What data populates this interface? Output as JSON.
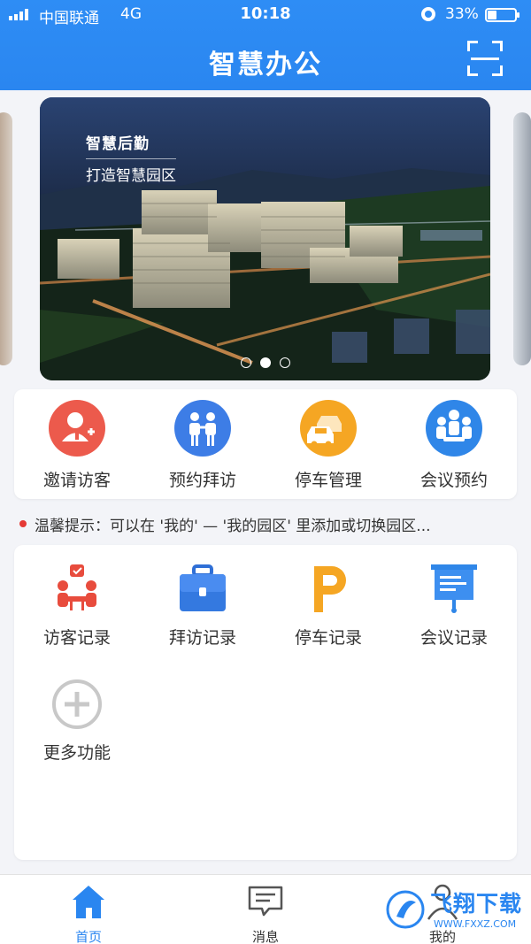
{
  "status_bar": {
    "carrier": "中国联通",
    "network": "4G",
    "time": "10:18",
    "battery": "33%"
  },
  "header": {
    "title": "智慧办公",
    "scan_icon": "scan-icon"
  },
  "banner": {
    "line1": "智慧后勤",
    "line2": "打造智慧园区",
    "slides": 3,
    "active_slide": 2
  },
  "quick_actions": [
    {
      "label": "邀请访客",
      "icon": "invite-visitor-icon",
      "color": "#ec5a4c"
    },
    {
      "label": "预约拜访",
      "icon": "appointment-visit-icon",
      "color": "#3d7de6"
    },
    {
      "label": "停车管理",
      "icon": "parking-management-icon",
      "color": "#f5a623"
    },
    {
      "label": "会议预约",
      "icon": "meeting-booking-icon",
      "color": "#2f86e8"
    }
  ],
  "notice": "温馨提示：可以在 '我的' — '我的园区' 里添加或切换园区...",
  "functions": [
    {
      "label": "访客记录",
      "icon": "visitor-record-icon"
    },
    {
      "label": "拜访记录",
      "icon": "visit-record-icon"
    },
    {
      "label": "停车记录",
      "icon": "parking-record-icon"
    },
    {
      "label": "会议记录",
      "icon": "meeting-record-icon"
    },
    {
      "label": "更多功能",
      "icon": "more-functions-icon"
    }
  ],
  "tabbar": [
    {
      "label": "首页",
      "icon": "home-icon",
      "active": true
    },
    {
      "label": "消息",
      "icon": "message-icon",
      "active": false
    },
    {
      "label": "我的",
      "icon": "profile-icon",
      "active": false
    }
  ],
  "watermark": {
    "main": "飞翔下载",
    "sub": "WWW.FXXZ.COM"
  },
  "colors": {
    "primary": "#2a86f0",
    "notice_dot": "#e53935",
    "background": "#f3f4f8"
  }
}
